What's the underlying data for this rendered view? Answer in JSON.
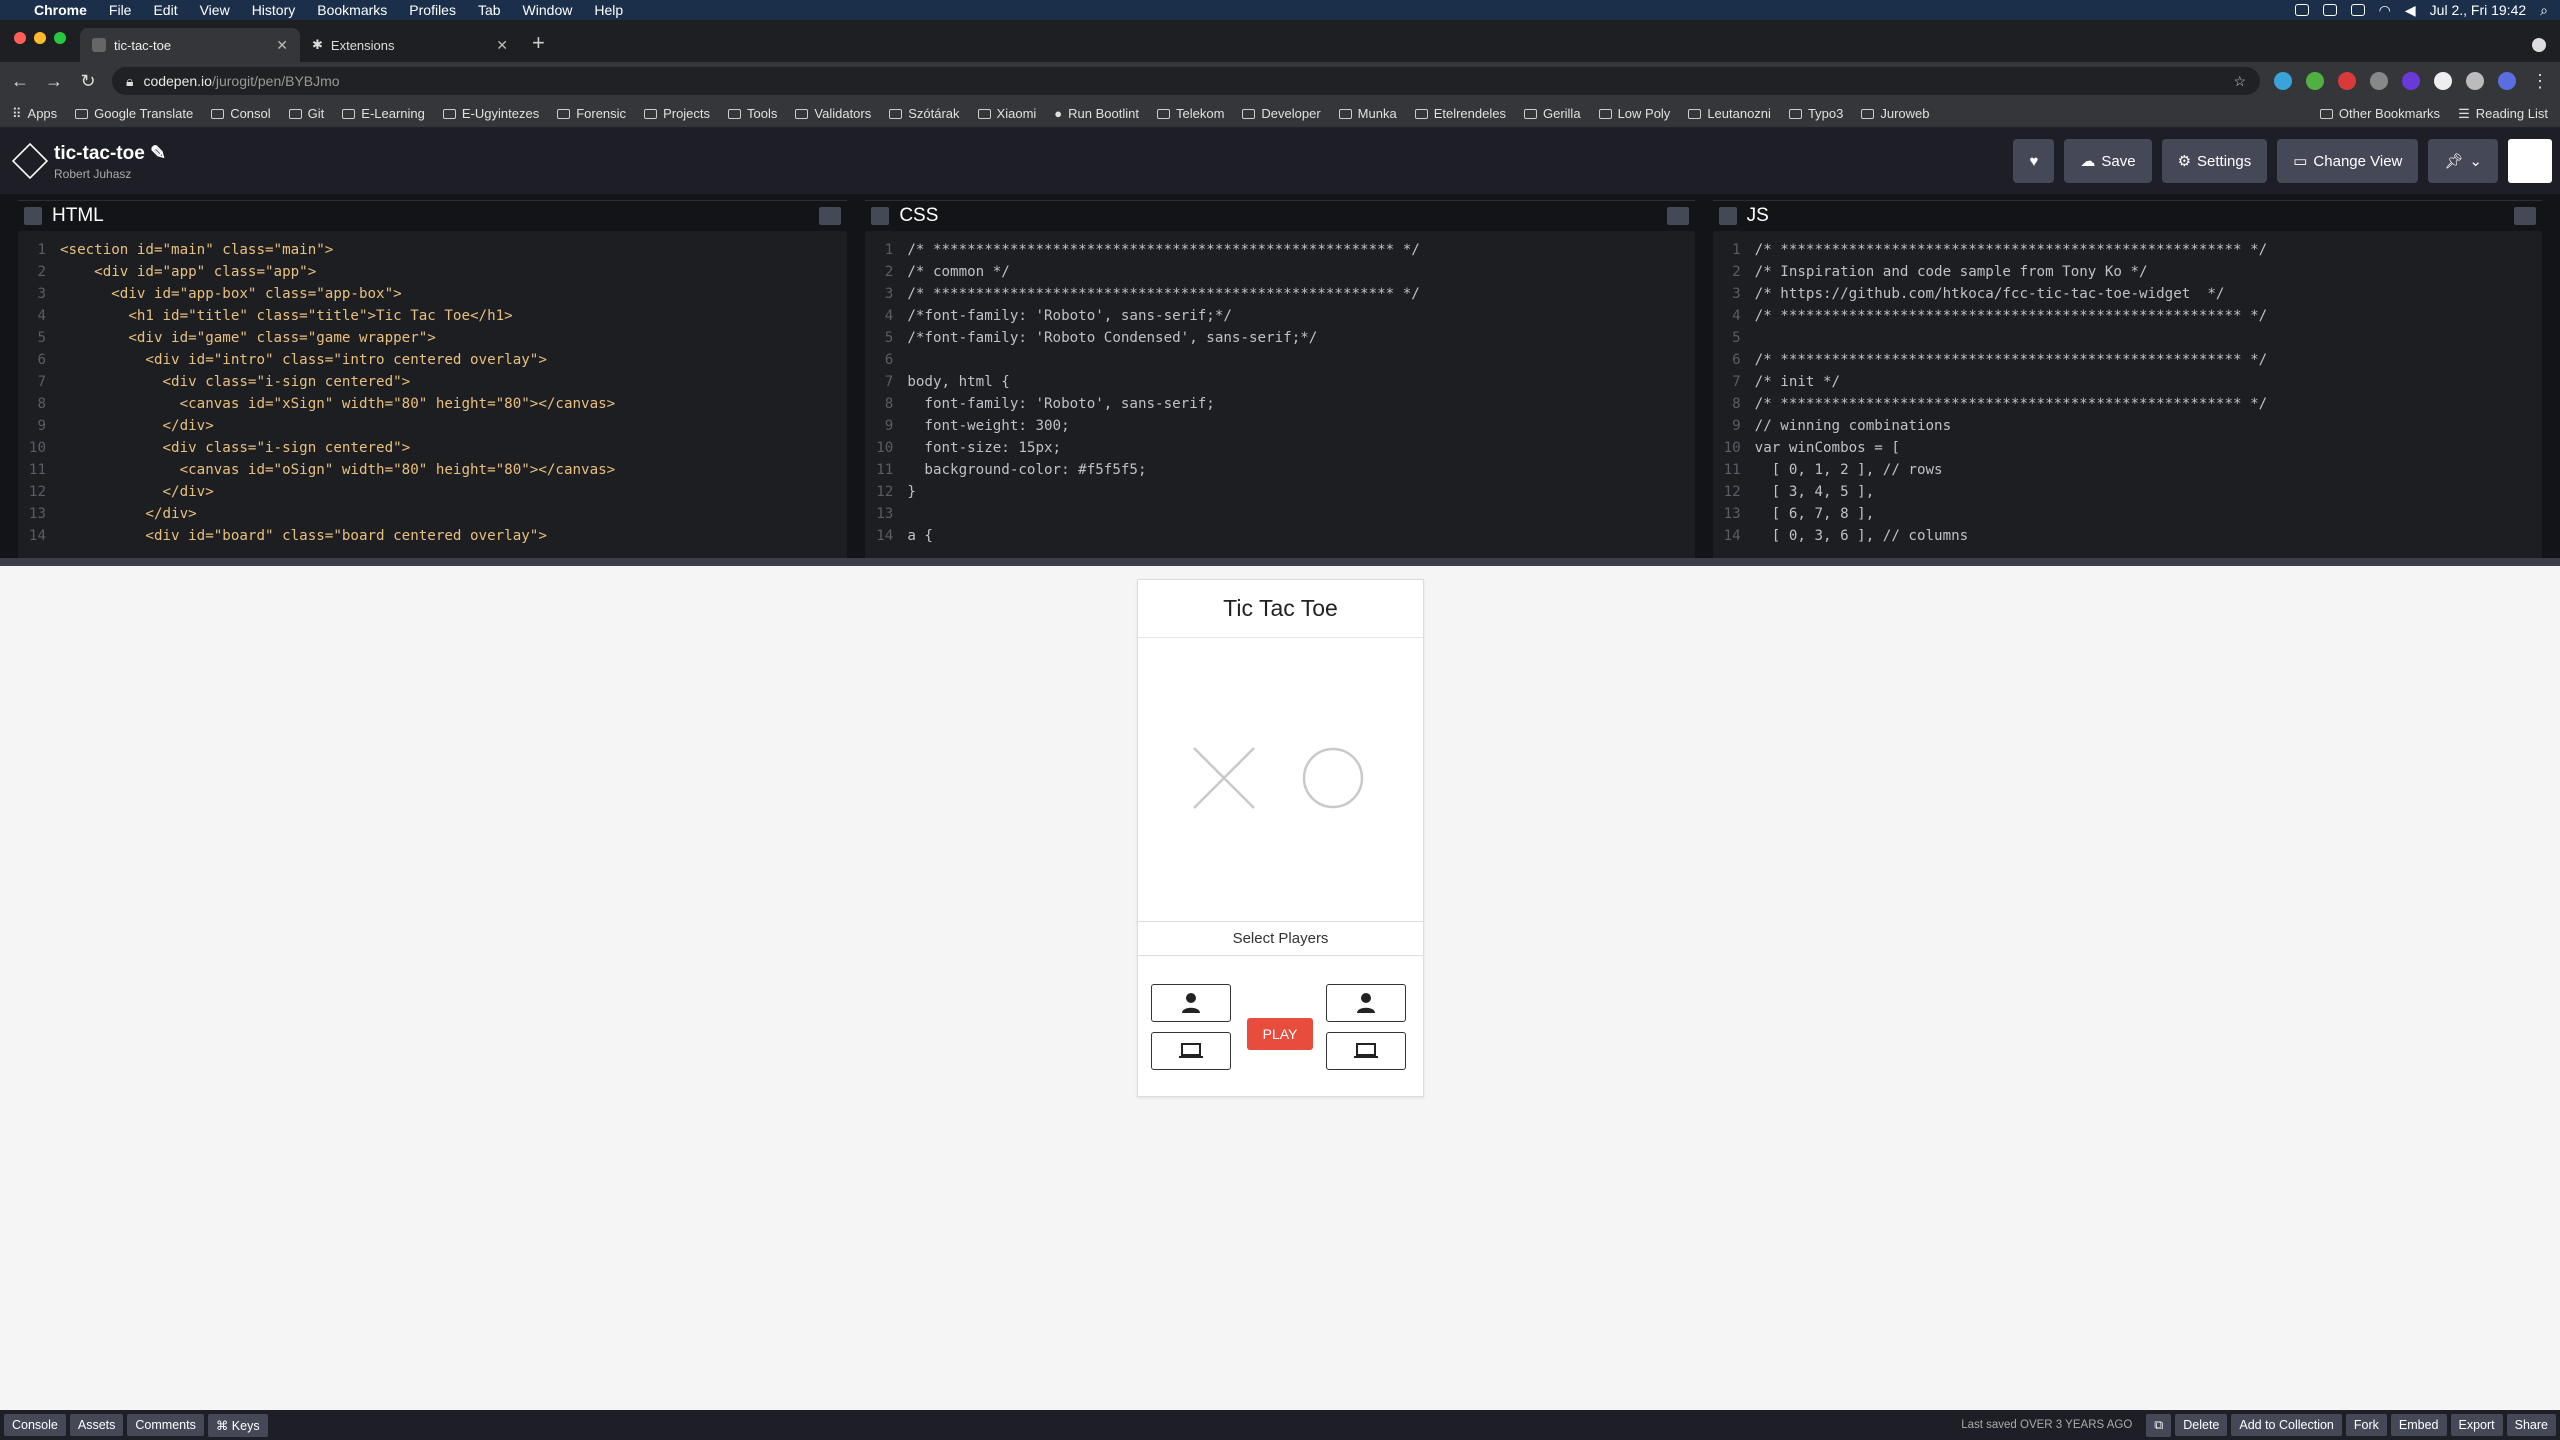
{
  "menubar": {
    "app": "Chrome",
    "items": [
      "File",
      "Edit",
      "View",
      "History",
      "Bookmarks",
      "Profiles",
      "Tab",
      "Window",
      "Help"
    ],
    "clock": "Jul 2., Fri 19:42"
  },
  "tabs": [
    {
      "label": "tic-tac-toe",
      "active": true
    },
    {
      "label": "Extensions",
      "active": false
    }
  ],
  "address": {
    "host": "codepen.io",
    "path": "/jurogit/pen/BYBJmo"
  },
  "bookmarks": {
    "items": [
      "Apps",
      "Google Translate",
      "Consol",
      "Git",
      "E-Learning",
      "E-Ugyintezes",
      "Forensic",
      "Projects",
      "Tools",
      "Validators",
      "Szótárak",
      "Xiaomi",
      "Run Bootlint",
      "Telekom",
      "Developer",
      "Munka",
      "Etelrendeles",
      "Gerilla",
      "Low Poly",
      "Leutanozni",
      "Typo3",
      "Juroweb"
    ],
    "other": "Other Bookmarks",
    "reading": "Reading List"
  },
  "pen": {
    "title": "tic-tac-toe",
    "author": "Robert Juhasz",
    "save": "Save",
    "settings": "Settings",
    "change_view": "Change View"
  },
  "editors": {
    "html": {
      "label": "HTML",
      "lines": [
        "<section id=\"main\" class=\"main\">",
        "    <div id=\"app\" class=\"app\">",
        "      <div id=\"app-box\" class=\"app-box\">",
        "        <h1 id=\"title\" class=\"title\">Tic Tac Toe</h1>",
        "        <div id=\"game\" class=\"game wrapper\">",
        "          <div id=\"intro\" class=\"intro centered overlay\">",
        "            <div class=\"i-sign centered\">",
        "              <canvas id=\"xSign\" width=\"80\" height=\"80\"></canvas>",
        "            </div>",
        "            <div class=\"i-sign centered\">",
        "              <canvas id=\"oSign\" width=\"80\" height=\"80\"></canvas>",
        "            </div>",
        "          </div>",
        "          <div id=\"board\" class=\"board centered overlay\">"
      ]
    },
    "css": {
      "label": "CSS",
      "lines": [
        "/* ****************************************************** */",
        "/* common */",
        "/* ****************************************************** */",
        "/*font-family: 'Roboto', sans-serif;*/",
        "/*font-family: 'Roboto Condensed', sans-serif;*/",
        "",
        "body, html {",
        "  font-family: 'Roboto', sans-serif;",
        "  font-weight: 300;",
        "  font-size: 15px;",
        "  background-color: #f5f5f5;",
        "}",
        "",
        "a {"
      ]
    },
    "js": {
      "label": "JS",
      "lines": [
        "/* ****************************************************** */",
        "/* Inspiration and code sample from Tony Ko */",
        "/* https://github.com/htkoca/fcc-tic-tac-toe-widget  */",
        "/* ****************************************************** */",
        "",
        "/* ****************************************************** */",
        "/* init */",
        "/* ****************************************************** */",
        "// winning combinations",
        "var winCombos = [",
        "  [ 0, 1, 2 ], // rows",
        "  [ 3, 4, 5 ],",
        "  [ 6, 7, 8 ],",
        "  [ 0, 3, 6 ], // columns"
      ]
    }
  },
  "game": {
    "title": "Tic Tac Toe",
    "select_label": "Select Players",
    "play": "PLAY"
  },
  "statusbar": {
    "left": [
      "Console",
      "Assets",
      "Comments",
      "⌘ Keys"
    ],
    "saved": "Last saved OVER 3 YEARS AGO",
    "right": [
      "Delete",
      "Add to Collection",
      "Fork",
      "Embed",
      "Export",
      "Share"
    ]
  }
}
